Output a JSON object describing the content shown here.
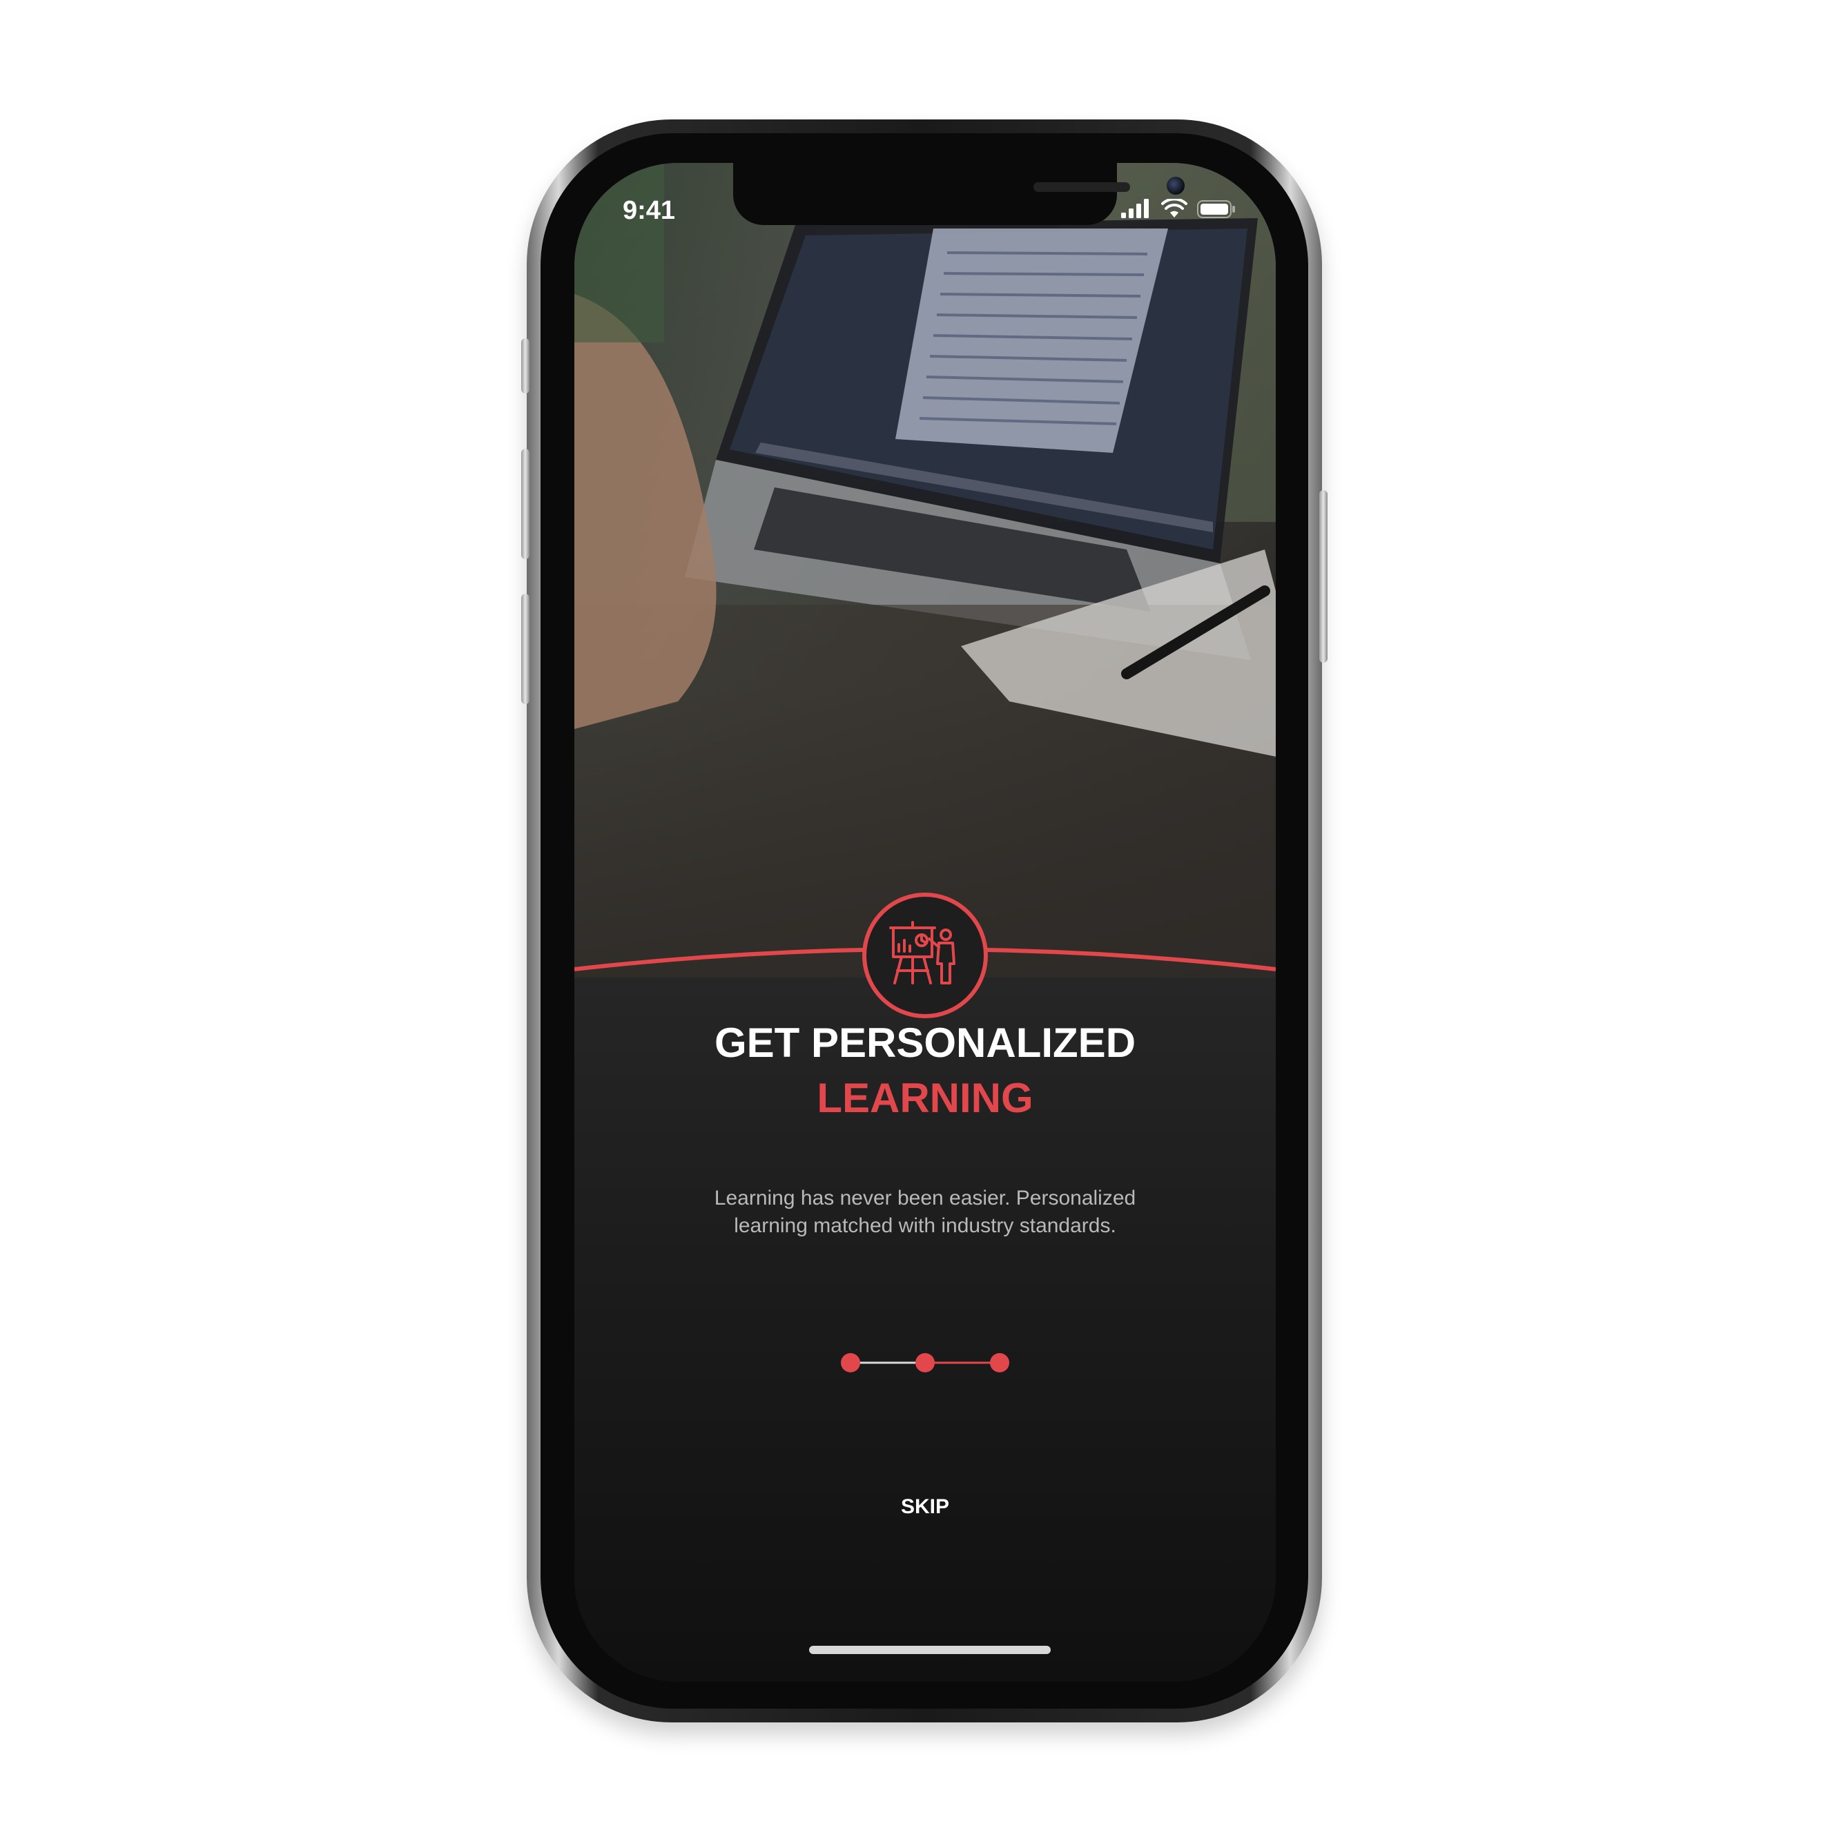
{
  "status_bar": {
    "time": "9:41",
    "icons": [
      "signal-icon",
      "wifi-icon",
      "battery-icon"
    ]
  },
  "onboarding": {
    "title_line1": "GET PERSONALIZED",
    "title_line2": "LEARNING",
    "description_line1": "Learning has never been easier. Personalized",
    "description_line2": "learning matched with industry standards.",
    "skip_label": "SKIP",
    "feature_icon": "presentation-board-icon",
    "page_count": 3,
    "current_page": 3
  },
  "colors": {
    "accent": "#e2474b",
    "background": "#1b1b1b",
    "text_primary": "#ffffff",
    "text_secondary": "#b9b9b9"
  }
}
